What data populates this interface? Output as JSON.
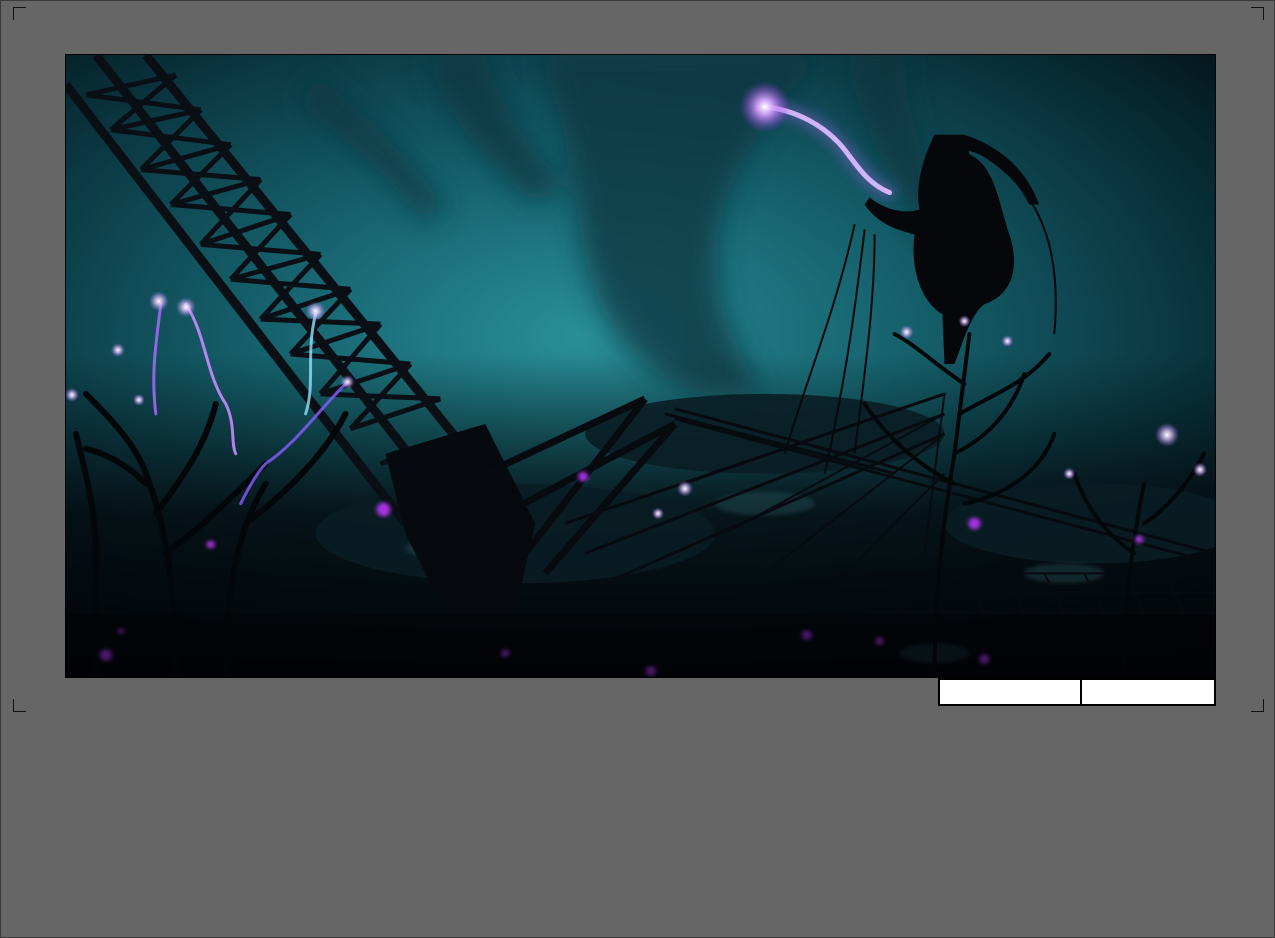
{
  "viewer": {
    "frame_fields": [
      "",
      ""
    ]
  },
  "artwork": {
    "subject": "underwater-scene-silhouette",
    "palette": {
      "water_light": "#1f7f8a",
      "water_mid": "#0e4a55",
      "water_dark": "#04161c",
      "silhouette": "#05080c",
      "glow_purple": "#c470ff",
      "glow_white": "#f4eaff",
      "glow_cyan": "#7fe8ff"
    }
  }
}
